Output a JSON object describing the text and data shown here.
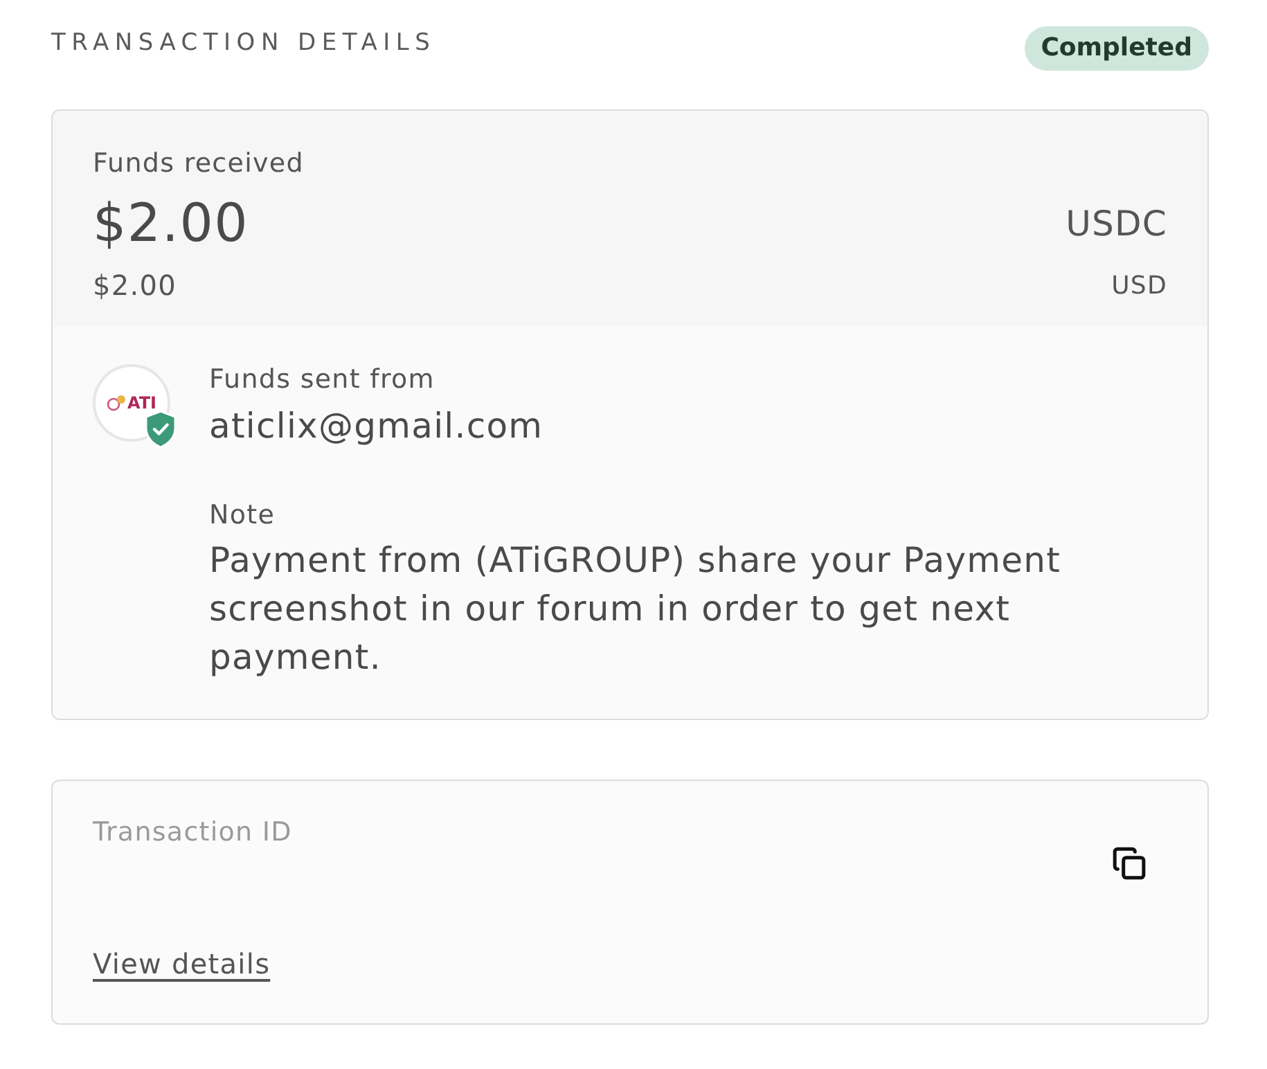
{
  "header": {
    "title": "TRANSACTION DETAILS",
    "status": {
      "label": "Completed",
      "kind": "completed"
    }
  },
  "amount_card": {
    "label": "Funds received",
    "amount": "$2.00",
    "currency": "USDC",
    "fiat_amount": "$2.00",
    "fiat_currency": "USD"
  },
  "sender": {
    "label": "Funds sent from",
    "logo_text": "ATI",
    "verified": true,
    "email": "aticlix@gmail.com"
  },
  "note": {
    "label": "Note",
    "text": "Payment from (ATiGROUP) share your Payment screenshot in our forum in order to get next payment."
  },
  "transaction_card": {
    "label": "Transaction ID",
    "link": "View details"
  }
}
